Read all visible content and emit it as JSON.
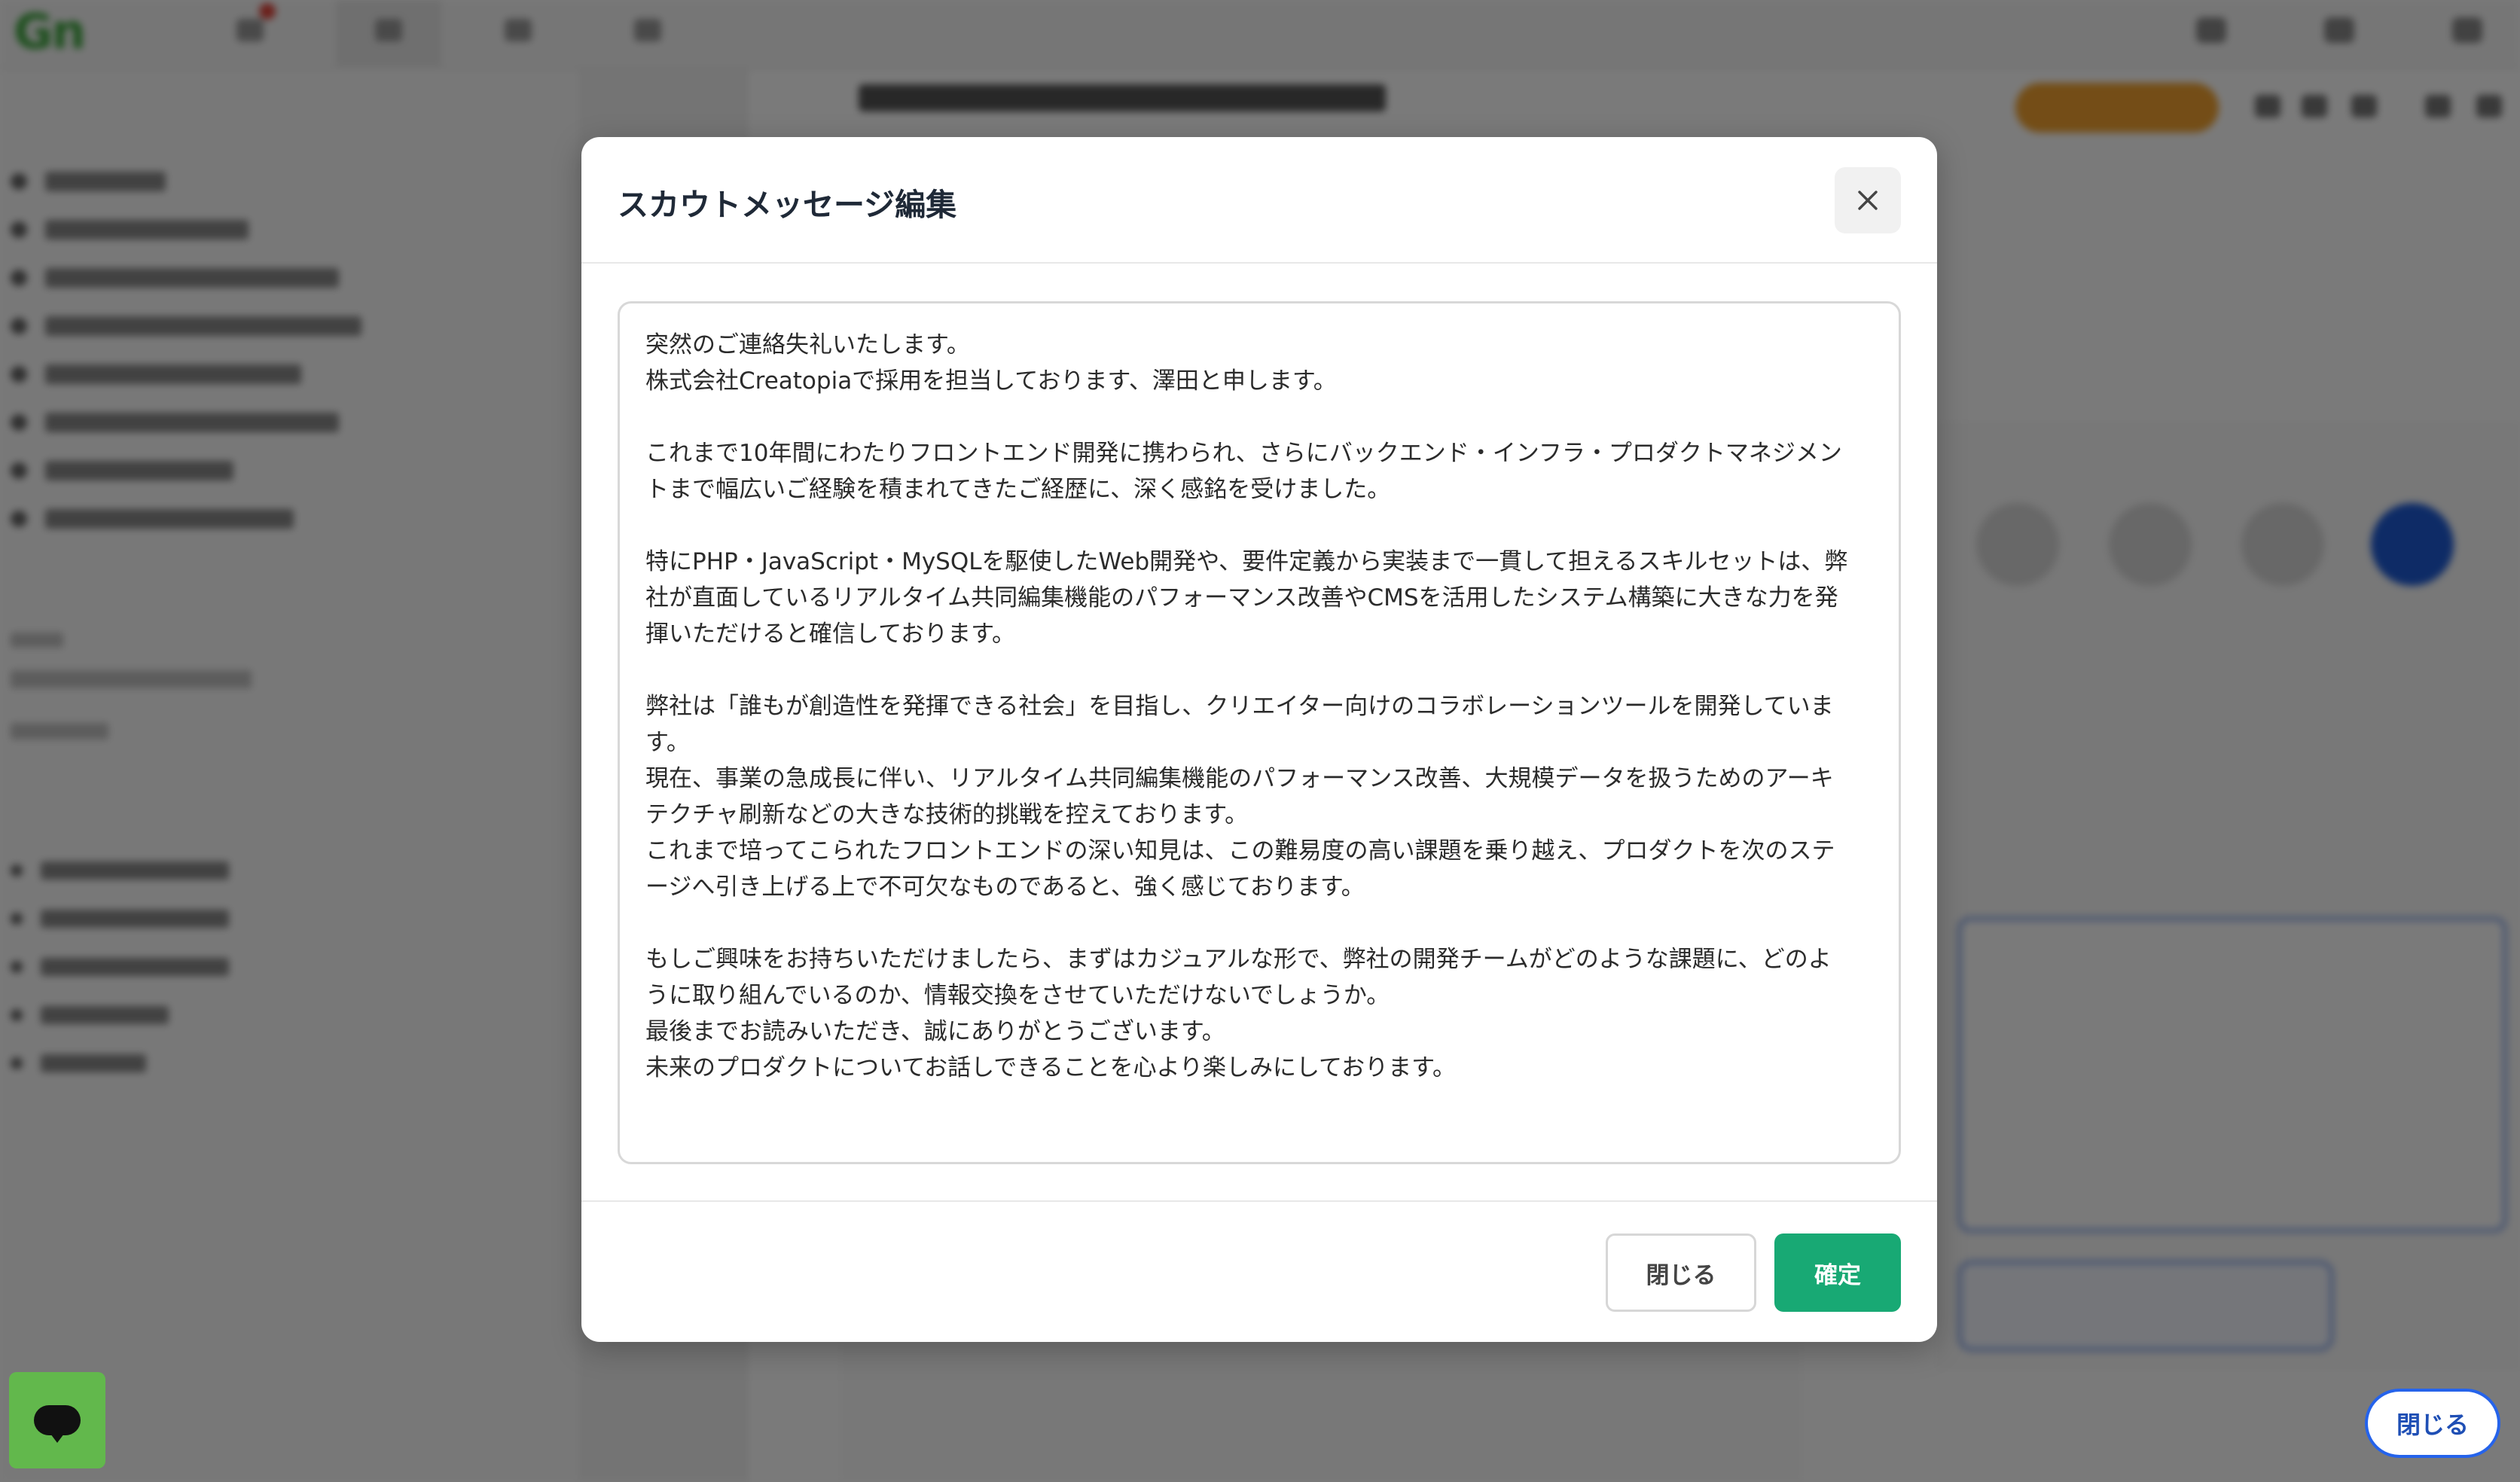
{
  "colors": {
    "brand_green": "#62b84c",
    "confirm_green": "#18a974",
    "accent_blue": "#2563eb",
    "orange": "#f2a230",
    "overlay": "rgba(0,0,0,0.52)"
  },
  "modal": {
    "title": "スカウトメッセージ編集",
    "close_icon": "close-icon",
    "message_lines": [
      "突然のご連絡失礼いたします。",
      "株式会社Creatopiaで採用を担当しております、澤田と申します。",
      "",
      "これまで10年間にわたりフロントエンド開発に携わられ、さらにバックエンド・インフラ・プロダクトマネジメン",
      "トまで幅広いご経験を積まれてきたご経歴に、深く感銘を受けました。",
      "",
      "特にPHP・JavaScript・MySQLを駆使したWeb開発や、要件定義から実装まで一貫して担えるスキルセットは、弊",
      "社が直面しているリアルタイム共同編集機能のパフォーマンス改善やCMSを活用したシステム構築に大きな力を発",
      "揮いただけると確信しております。",
      "",
      "弊社は「誰もが創造性を発揮できる社会」を目指し、クリエイター向けのコラボレーションツールを開発していま",
      "す。",
      "現在、事業の急成長に伴い、リアルタイム共同編集機能のパフォーマンス改善、大規模データを扱うためのアーキ",
      "テクチャ刷新などの大きな技術的挑戦を控えております。",
      "これまで培ってこられたフロントエンドの深い知見は、この難易度の高い課題を乗り越え、プロダクトを次のステ",
      "ージへ引き上げる上で不可欠なものであると、強く感じております。",
      "",
      "もしご興味をお持ちいただけましたら、まずはカジュアルな形で、弊社の開発チームがどのような課題に、どのよ",
      "うに取り組んでいるのか、情報交換をさせていただけないでしょうか。",
      "最後までお読みいただき、誠にありがとうございます。",
      "未来のプロダクトについてお話しできることを心より楽しみにしております。"
    ],
    "close_button": "閉じる",
    "confirm_button": "確定"
  },
  "floating": {
    "close_button": "閉じる",
    "chat_icon": "chat-icon"
  }
}
